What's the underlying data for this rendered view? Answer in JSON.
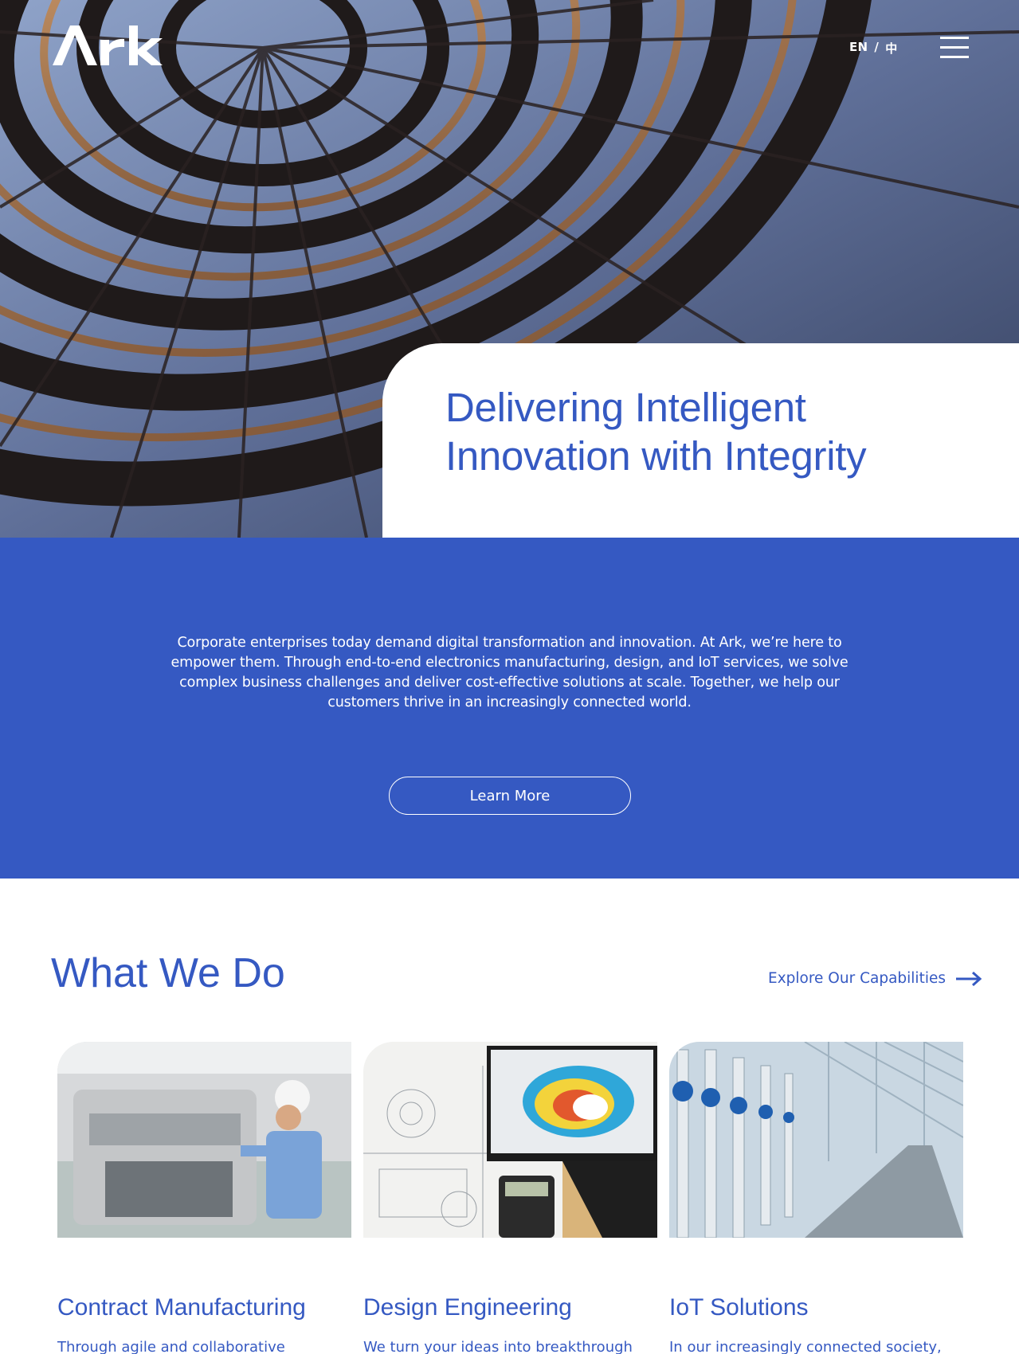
{
  "brand": {
    "logo_text": "Ark",
    "primary_color": "#3559c2"
  },
  "header": {
    "languages": [
      "EN",
      "/",
      "中"
    ],
    "menu_icon": "hamburger-menu-icon"
  },
  "hero": {
    "headline_line1": "Delivering Intelligent",
    "headline_line2": "Innovation with Integrity",
    "image": "spiral-glass-dome-photo"
  },
  "intro": {
    "text": "Corporate enterprises today demand digital transformation and innovation. At Ark, we’re here to empower them. Through end-to-end electronics manufacturing, design, and IoT services, we solve complex business challenges and deliver cost-effective solutions at scale. Together, we help our customers thrive in an increasingly connected world.",
    "button_label": "Learn More"
  },
  "what_we_do": {
    "title": "What We Do",
    "explore_label": "Explore Our Capabilities",
    "explore_icon": "arrow-right-icon",
    "cards": [
      {
        "title": "Contract Manufacturing",
        "text": "Through agile and collaborative manufacturing processes, we accurately",
        "image": "factory-worker-photo"
      },
      {
        "title": "Design Engineering",
        "text": "We turn your ideas into breakthrough designs. Using manufacturing expertise",
        "image": "cad-simulation-photo"
      },
      {
        "title": "IoT Solutions",
        "text": "In our increasingly connected society, the demand for IoT continues to grow. We",
        "image": "greenhouse-pipes-photo"
      }
    ]
  }
}
